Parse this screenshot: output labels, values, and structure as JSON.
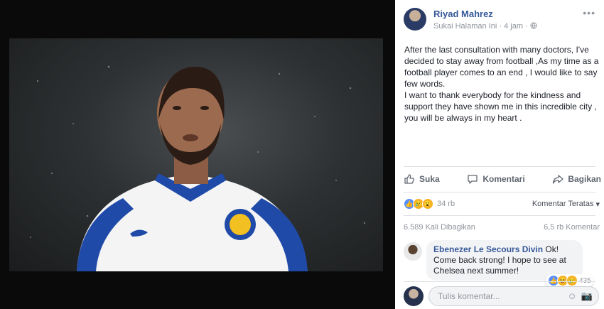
{
  "post": {
    "author": "Riyad Mahrez",
    "meta": {
      "page_link": "Sukai Halaman Ini",
      "separator": "·",
      "time": "4 jam",
      "privacy_icon": "globe-icon"
    },
    "more_icon": "more-options-icon",
    "paragraphs": [
      "After the last consultation with many doctors, I've decided to stay away from football ,As my time as a football player comes to an end , I would like to say few words.",
      "I want to thank everybody for the kindness and support they have shown me in this incredible city , you will be always in my heart ."
    ]
  },
  "photo": {
    "subject": "football player portrait",
    "shirt_color": "#ffffff",
    "accent_color": "#1f4aa8",
    "kit_brand": "puma",
    "badge_text": "LEICESTER CITY FOOTBALL CLUB"
  },
  "actions": {
    "like": "Suka",
    "comment": "Komentari",
    "share": "Bagikan"
  },
  "reactions": {
    "icons": [
      "like-icon",
      "sad-icon",
      "wow-icon"
    ],
    "count": "34 rb",
    "sort_label": "Komentar Teratas",
    "sort_icon": "dropdown-arrow-icon"
  },
  "stats": {
    "shares": "6.589 Kali Dibagikan",
    "comments": "6,5 rb Komentar"
  },
  "comment": {
    "author": "Ebenezer Le Secours Divin",
    "text": "Ok! Come back strong! I hope to see at Chelsea next summer!",
    "reaction_icons": [
      "like-icon",
      "haha-icon",
      "sad-icon"
    ],
    "reaction_count": "435"
  },
  "composer": {
    "placeholder": "Tulis komentar...",
    "icons": [
      "emoji-icon",
      "camera-icon"
    ]
  },
  "colors": {
    "link_blue": "#365899",
    "text_gray": "#606770",
    "meta_gray": "#90949c",
    "like_blue": "#5890ff",
    "reaction_yellow": "#f7b125"
  }
}
